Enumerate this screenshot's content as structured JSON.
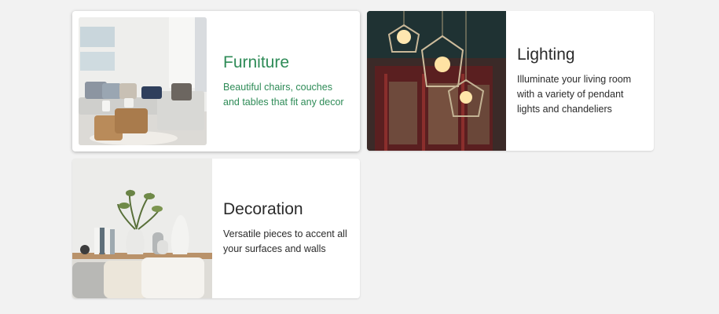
{
  "categories": [
    {
      "title": "Furniture",
      "description": "Beautiful chairs, couches and tables that fit any decor",
      "image": "living-room-sofa-photo"
    },
    {
      "title": "Lighting",
      "description": "Illuminate your living room with a variety of pendant lights and chandeliers",
      "image": "pendant-lights-photo"
    },
    {
      "title": "Decoration",
      "description": "Versatile pieces to accent all your surfaces and walls",
      "image": "vases-shelf-photo"
    }
  ],
  "colors": {
    "page_background": "#f2f2f2",
    "card_background": "#ffffff",
    "active_accent": "#2e8b57",
    "text": "#2b2b2b"
  }
}
